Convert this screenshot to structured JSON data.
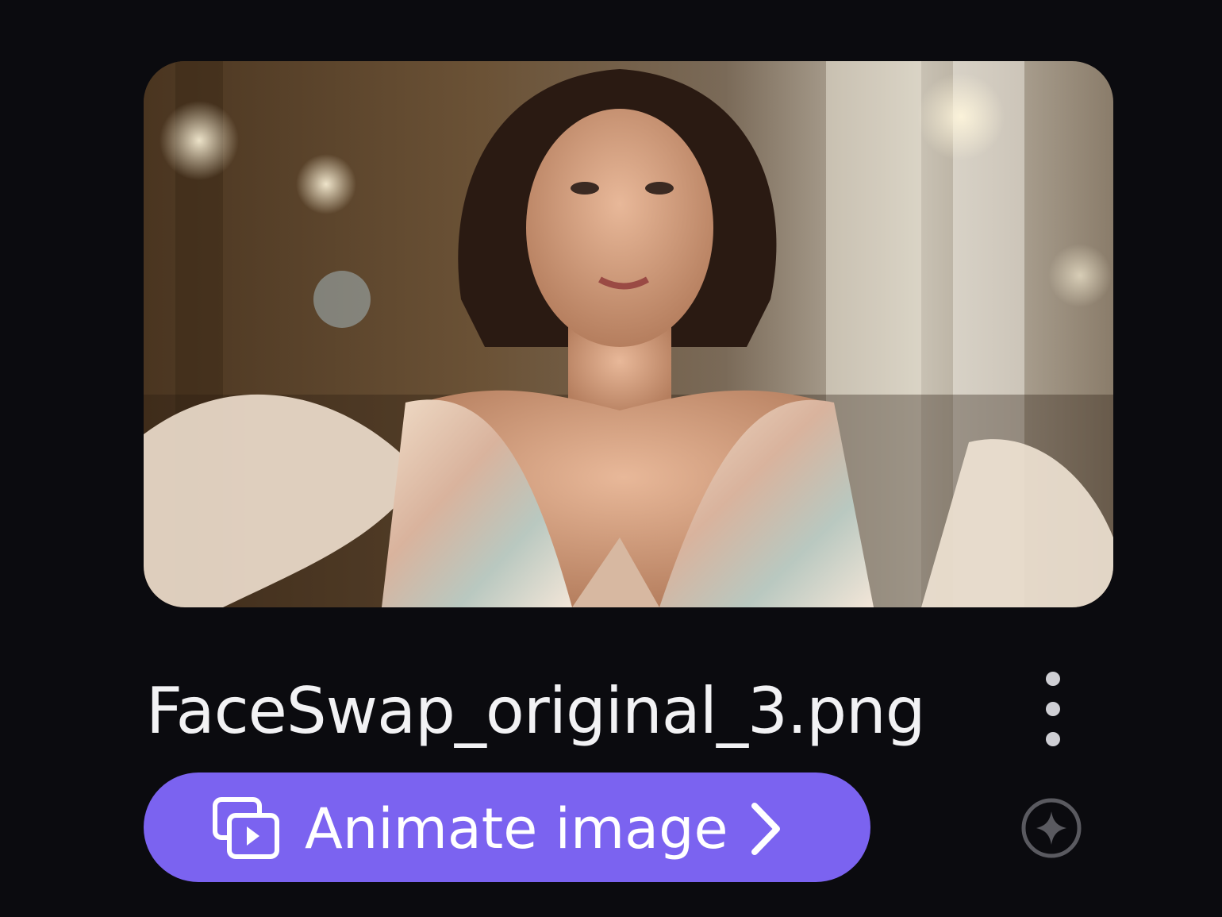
{
  "media_card": {
    "image_alt": "Woman in pastel flowing gown in a ballroom",
    "filename": "FaceSwap_original_3.png"
  },
  "actions": {
    "animate_label": "Animate image"
  },
  "icons": {
    "share": "share-icon",
    "more": "more-vert-icon",
    "animate": "animate-image-icon",
    "chevron": "chevron-right-icon",
    "sparkle": "sparkle-icon"
  },
  "colors": {
    "background": "#0b0b0f",
    "accent": "#7b63f0",
    "text": "#f2f2f4"
  }
}
